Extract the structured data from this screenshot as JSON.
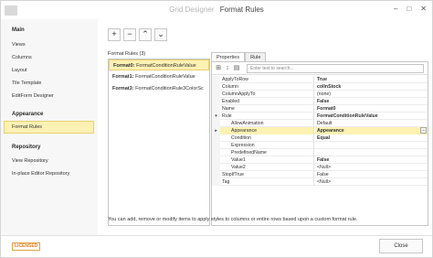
{
  "window": {
    "title_prefix": "Grid Designer",
    "title": "Format Rules",
    "minimize_label": "–",
    "maximize_label": "□",
    "close_label": "✕"
  },
  "sidebar": {
    "groups": [
      {
        "label": "Main",
        "items": [
          "Views",
          "Columns",
          "Layout",
          "Tile Template",
          "EditForm Designer"
        ]
      },
      {
        "label": "Appearance",
        "items": [
          "Format Rules"
        ]
      },
      {
        "label": "Repository",
        "items": [
          "View Repository",
          "In-place Editor Repository"
        ]
      }
    ],
    "selected": "Format Rules"
  },
  "toolbar": {
    "add_label": "+",
    "remove_label": "−",
    "up_label": "⌃",
    "down_label": "⌄"
  },
  "format_rules": {
    "label": "Format Rules (3)",
    "items": [
      {
        "key": "Format0:",
        "text": "FormatConditionRuleValue"
      },
      {
        "key": "Format1:",
        "text": "FormatConditionRuleValue"
      },
      {
        "key": "Format3:",
        "text": "FormatConditionRule3ColorSc"
      }
    ]
  },
  "tabs": [
    "Properties",
    "Rule"
  ],
  "property_grid": {
    "search_placeholder": "Enter text to search...",
    "rows": [
      {
        "name": "ApplyToRow",
        "value": "True",
        "bold": true
      },
      {
        "name": "Column",
        "value": "colInStock",
        "bold": true
      },
      {
        "name": "ColumnApplyTo",
        "value": "(none)",
        "bold": false
      },
      {
        "name": "Enabled",
        "value": "False",
        "bold": true
      },
      {
        "name": "Name",
        "value": "Format0",
        "bold": true
      },
      {
        "name": "Rule",
        "value": "FormatConditionRuleValue",
        "bold": true,
        "toggle": "▾"
      },
      {
        "name": "AllowAnimation",
        "value": "Default",
        "bold": false,
        "indent": 1
      },
      {
        "name": "Appearance",
        "value": "Appearance",
        "bold": true,
        "indent": 1,
        "toggle": "▸",
        "highlight": true
      },
      {
        "name": "Condition",
        "value": "Equal",
        "bold": true,
        "indent": 1
      },
      {
        "name": "Expression",
        "value": "",
        "bold": false,
        "indent": 1
      },
      {
        "name": "PredefinedName",
        "value": "",
        "bold": false,
        "indent": 1
      },
      {
        "name": "Value1",
        "value": "False",
        "bold": true,
        "indent": 1
      },
      {
        "name": "Value2",
        "value": "<Null>",
        "bold": false,
        "indent": 1
      },
      {
        "name": "StopIfTrue",
        "value": "False",
        "bold": false
      },
      {
        "name": "Tag",
        "value": "<Null>",
        "bold": false
      }
    ],
    "ellipsis_label": "..."
  },
  "hint": "You can add, remove or modify items to apply styles to columns or entire rows based upon a custom format rule.",
  "footer": {
    "license_label": "LICENSED",
    "close_label": "Close"
  },
  "colors": {
    "selection": "#fdf1b3",
    "selection_border": "#e8d070",
    "license": "#d9801d"
  }
}
